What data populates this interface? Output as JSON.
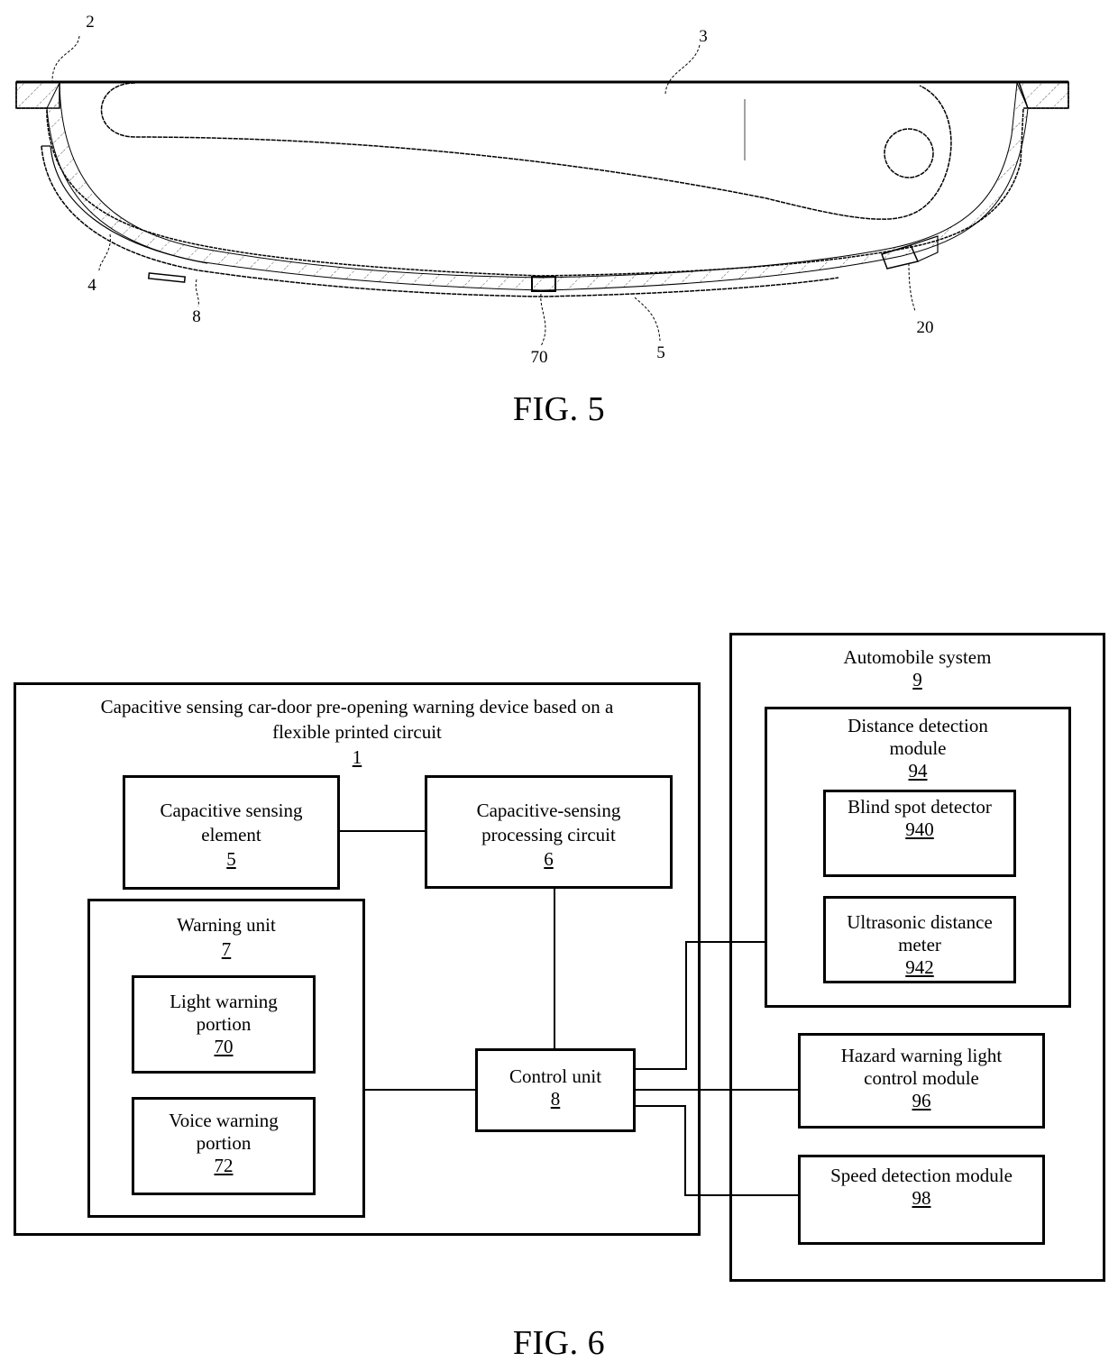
{
  "figures": {
    "fig5": {
      "caption": "FIG. 5",
      "reference_labels": [
        "2",
        "3",
        "4",
        "8",
        "70",
        "5",
        "20"
      ]
    },
    "fig6": {
      "caption": "FIG. 6",
      "device": {
        "title": "Capacitive sensing car-door pre-opening warning device based on a flexible printed circuit",
        "title_line1": "Capacitive sensing car-door pre-opening warning device based on a",
        "title_line2": "flexible printed circuit",
        "number": "1",
        "sensing_element": {
          "line1": "Capacitive sensing",
          "line2": "element",
          "number": "5"
        },
        "processing_circuit": {
          "line1": "Capacitive-sensing",
          "line2": "processing circuit",
          "number": "6"
        },
        "warning_unit": {
          "label": "Warning unit",
          "number": "7",
          "light": {
            "line1": "Light warning",
            "line2": "portion",
            "number": "70"
          },
          "voice": {
            "line1": "Voice warning",
            "line2": "portion",
            "number": "72"
          }
        },
        "control_unit": {
          "label": "Control unit",
          "number": "8"
        }
      },
      "automobile_system": {
        "label": "Automobile system",
        "number": "9",
        "distance_module": {
          "line1": "Distance detection",
          "line2": "module",
          "number": "94",
          "blind_spot": {
            "label": "Blind spot detector",
            "number": "940"
          },
          "ultrasonic": {
            "line1": "Ultrasonic distance",
            "line2": "meter",
            "number": "942"
          }
        },
        "hazard_module": {
          "line1": "Hazard warning light",
          "line2": "control module",
          "number": "96"
        },
        "speed_module": {
          "label": "Speed detection module",
          "number": "98"
        }
      }
    }
  }
}
